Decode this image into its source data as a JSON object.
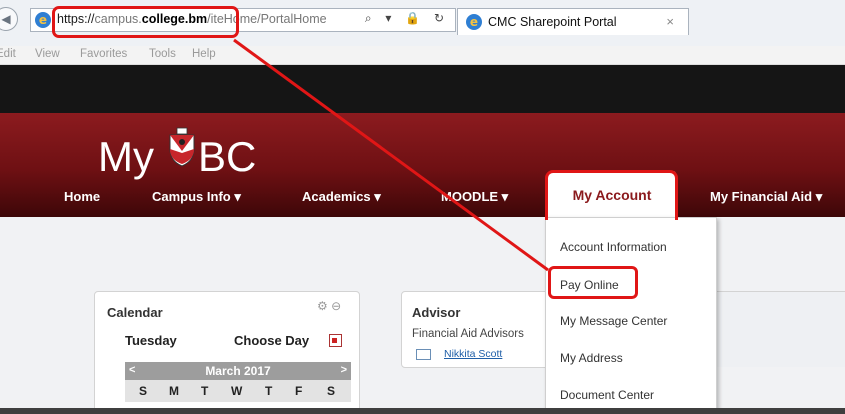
{
  "browser": {
    "url_prefix": "https://",
    "url_host_dim": "campus.",
    "url_host_hl": "college.bm",
    "url_tail": "/",
    "url_path": "iteHome/PortalHome",
    "url_tools": "⌕ ▾ 🔒 ↻",
    "tab_title": "CMC Sharepoint Portal",
    "tab_close": "×",
    "menus": [
      "Edit",
      "View",
      "Favorites",
      "Tools",
      "Help"
    ]
  },
  "site": {
    "logo_my": "My",
    "logo_bc": "BC",
    "nav": {
      "home": "Home",
      "campus_info": "Campus Info ▾",
      "academics": "Academics ▾",
      "moodle": "MOODLE ▾",
      "my_account": "My Account",
      "my_financial_aid": "My Financial Aid ▾"
    },
    "dropdown": [
      "Account Information",
      "Pay Online",
      "My Message Center",
      "My Address",
      "Document Center"
    ]
  },
  "calendar": {
    "title": "Calendar",
    "day": "Tuesday",
    "choose": "Choose Day",
    "prev": "<",
    "next": ">",
    "month": "March 2017",
    "dow": [
      "S",
      "M",
      "T",
      "W",
      "T",
      "F",
      "S"
    ],
    "controls": "⚙ ⊖"
  },
  "advisor": {
    "title": "Advisor",
    "subtitle": "Financial Aid Advisors",
    "name": "Nikkita Scott"
  },
  "colors": {
    "header_red": "#8c1b1f",
    "callout_red": "#e01616",
    "active_text": "#8b1a1d"
  }
}
